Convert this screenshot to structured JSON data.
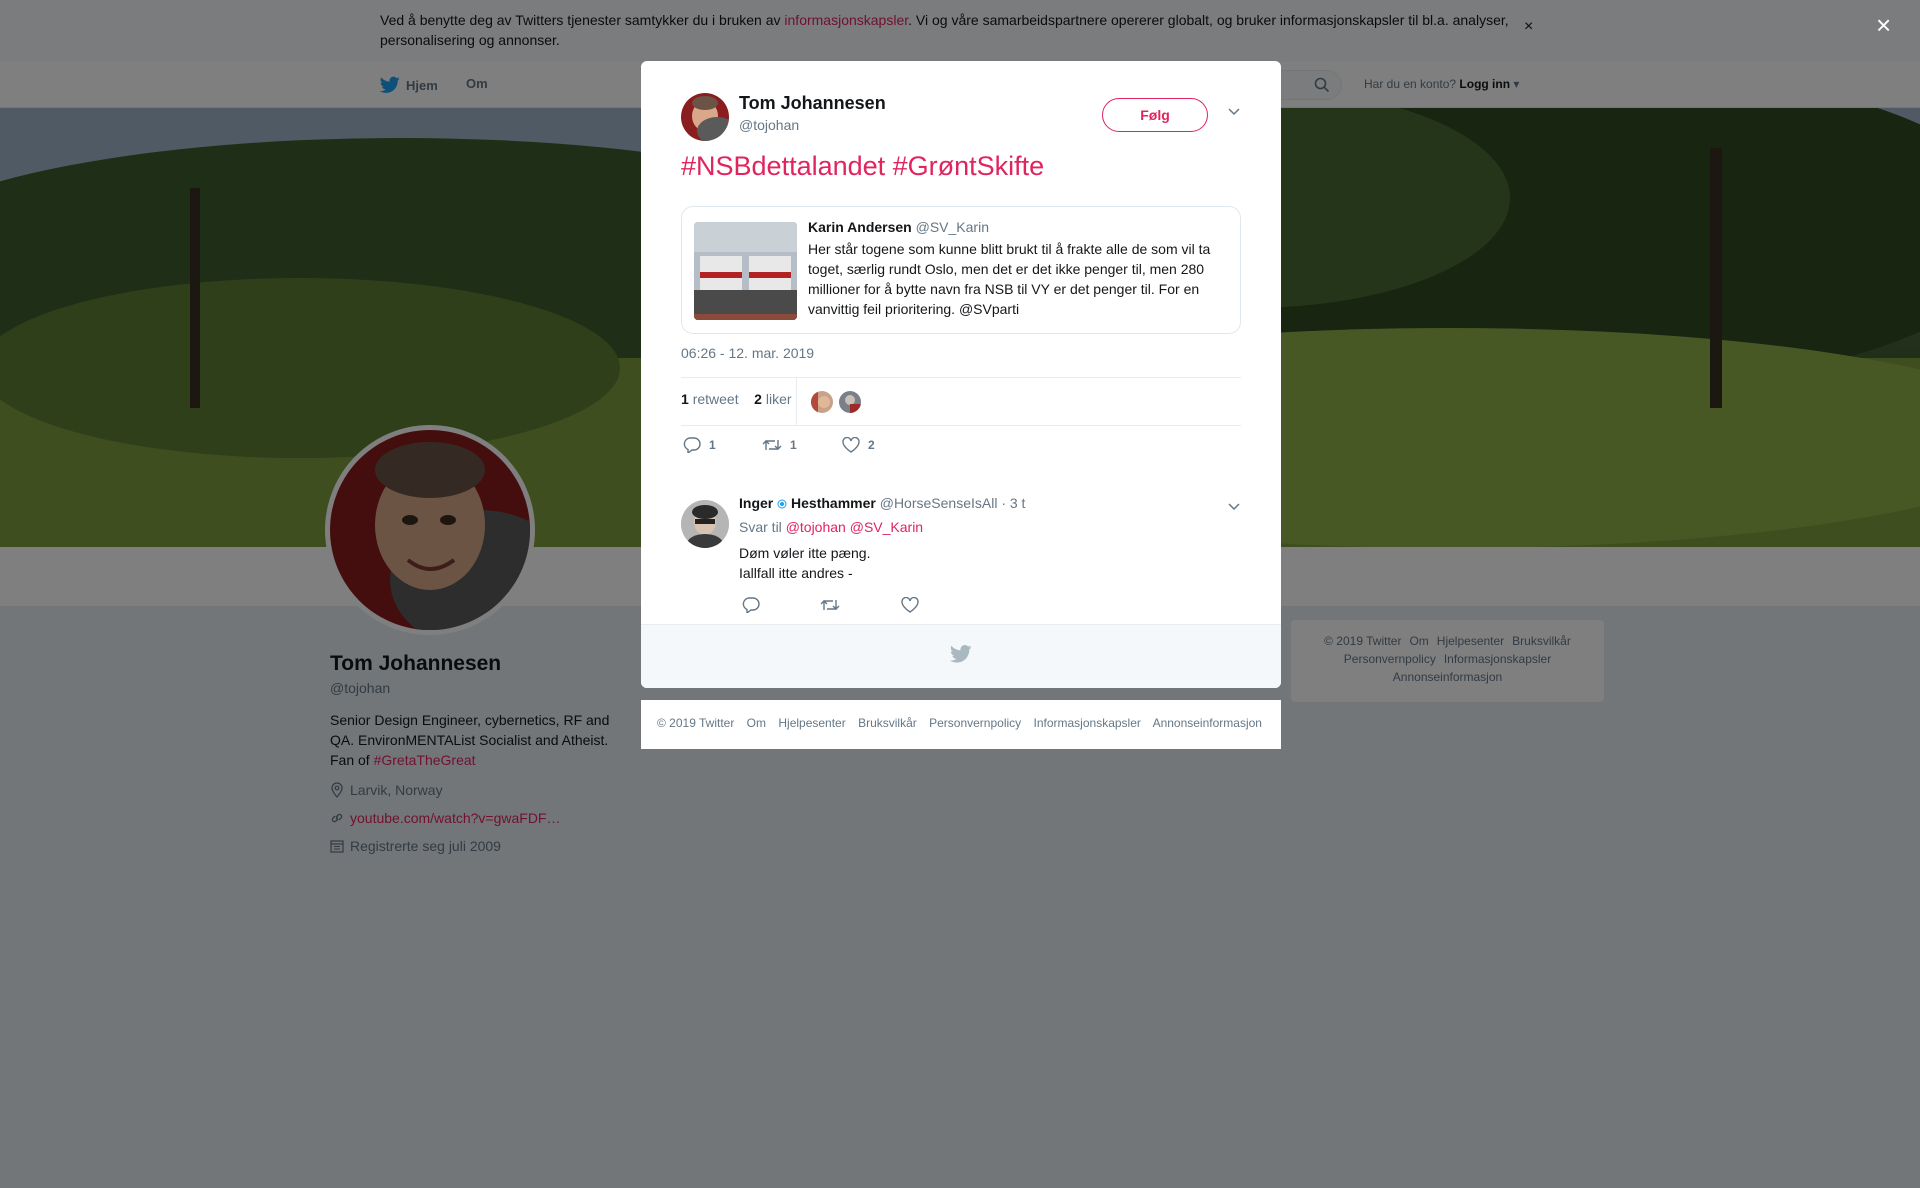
{
  "cookie": {
    "text_before": "Ved å benytte deg av Twitters tjenester samtykker du i bruken av ",
    "link": "informasjonskapsler",
    "text_after": ". Vi og våre samarbeidspartnere opererer globalt, og bruker informasjonskapsler til bl.a. analyser, personalisering og annonser.",
    "close": "×"
  },
  "topnav": {
    "home": "Hjem",
    "about": "Om",
    "account_prompt": "Har du en konto?",
    "login": "Logg inn"
  },
  "profile": {
    "name": "Tom Johannesen",
    "handle": "@tojohan",
    "bio": "Senior Design Engineer, cybernetics, RF and QA. EnvironMENTAList Socialist and Atheist. Fan of ",
    "bio_tag": "#GretaTheGreat",
    "location": "Larvik, Norway",
    "url": "youtube.com/watch?v=gwaFDF…",
    "joined": "Registrerte seg juli 2009"
  },
  "side_footer": {
    "items": [
      "© 2019 Twitter",
      "Om",
      "Hjelpesenter",
      "Bruksvilkår",
      "Personvernpolicy",
      "Informasjonskapsler",
      "Annonseinformasjon"
    ]
  },
  "modal": {
    "close": "×",
    "author_name": "Tom Johannesen",
    "author_handle": "@tojohan",
    "follow": "Følg",
    "tweet_text": "#NSBdettalandet #GrøntSkifte",
    "quote": {
      "name": "Karin Andersen",
      "handle": "@SV_Karin",
      "text": "Her står togene som kunne blitt brukt til å frakte alle de som vil ta toget, særlig rundt Oslo, men det er det ikke penger til, men 280 millioner for å bytte navn fra NSB til VY er det penger til. For en vanvittig feil prioritering. @SVparti"
    },
    "timestamp": "06:26 - 12. mar. 2019",
    "retweets_count": "1",
    "retweets_label": "retweet",
    "likes_count": "2",
    "likes_label": "liker",
    "actions": {
      "reply": "1",
      "retweet": "1",
      "like": "2"
    },
    "reply": {
      "name_first": "Inger",
      "name_last": "Hesthammer",
      "handle": "@HorseSenseIsAll",
      "time": "· 3 t",
      "reply_to_label": "Svar til",
      "reply_to_1": "@tojohan",
      "reply_to_2": "@SV_Karin",
      "line1": "Døm vøler itte pæng.",
      "line2": "Iallfall itte andres -"
    }
  },
  "modal_footer": {
    "items": [
      "© 2019 Twitter",
      "Om",
      "Hjelpesenter",
      "Bruksvilkår",
      "Personvernpolicy",
      "Informasjonskapsler",
      "Annonseinformasjon"
    ]
  },
  "colors": {
    "accent": "#e0245e",
    "twitter_blue": "#1da1f2",
    "muted": "#657786"
  },
  "icons": [
    "twitter-bird-icon",
    "search-icon",
    "chevron-down-icon",
    "close-icon",
    "location-icon",
    "link-icon",
    "calendar-icon",
    "reply-icon",
    "retweet-icon",
    "like-icon",
    "verified-icon"
  ]
}
